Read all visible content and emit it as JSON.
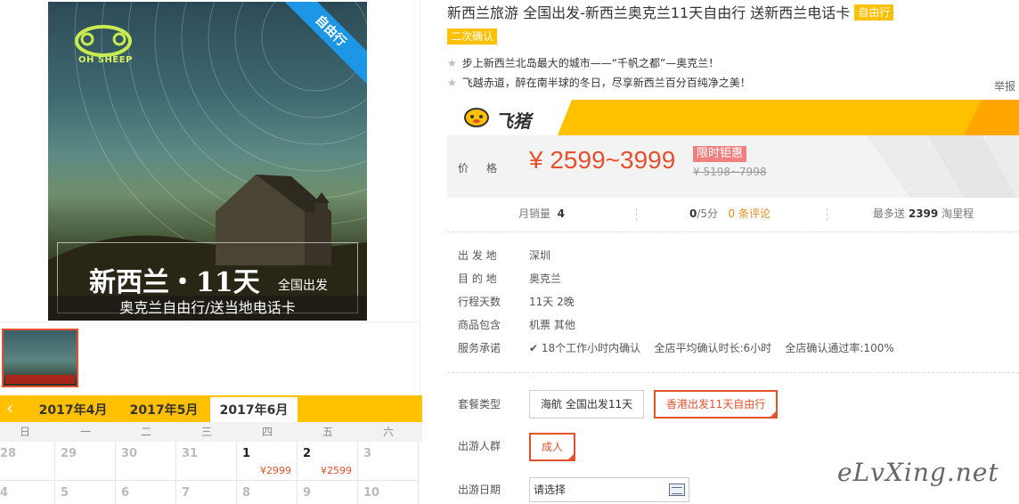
{
  "gallery": {
    "ribbon": "自由行",
    "logo_text": "OH SHEEP",
    "image_title": "新西兰・11天",
    "image_subtitle": "全国出发",
    "image_caption": "奥克兰自由行/送当地电话卡"
  },
  "calendar": {
    "prev_icon": "chevron-left-icon",
    "tabs": [
      {
        "label": "2017年4月",
        "active": false
      },
      {
        "label": "2017年5月",
        "active": false
      },
      {
        "label": "2017年6月",
        "active": true
      }
    ],
    "weekdays": [
      "日",
      "一",
      "二",
      "三",
      "四",
      "五",
      "六"
    ],
    "week1": [
      {
        "day": "28",
        "price": "",
        "on": false
      },
      {
        "day": "29",
        "price": "",
        "on": false
      },
      {
        "day": "30",
        "price": "",
        "on": false
      },
      {
        "day": "31",
        "price": "",
        "on": false
      },
      {
        "day": "1",
        "price": "¥2999",
        "on": true
      },
      {
        "day": "2",
        "price": "¥2599",
        "on": true
      },
      {
        "day": "3",
        "price": "",
        "on": false
      }
    ],
    "week2": [
      {
        "day": "4",
        "price": "",
        "on": false
      },
      {
        "day": "5",
        "price": "",
        "on": false
      },
      {
        "day": "6",
        "price": "",
        "on": false
      },
      {
        "day": "7",
        "price": "",
        "on": false
      },
      {
        "day": "8",
        "price": "",
        "on": false
      },
      {
        "day": "9",
        "price": "",
        "on": false
      },
      {
        "day": "10",
        "price": "",
        "on": false
      }
    ]
  },
  "product": {
    "title": "新西兰旅游 全国出发-新西兰奥克兰11天自由行 送新西兰电话卡",
    "tag_free": "自由行",
    "tag_confirm": "二次确认",
    "features": [
      "步上新西兰北岛最大的城市——“千帆之都”—奥克兰！",
      "飞越赤道，醉在南半球的冬日，尽享新西兰百分百纯净之美！"
    ],
    "report": "举报"
  },
  "price_box": {
    "brand": "飞猪",
    "label": "价格",
    "price": "¥ 2599~3999",
    "promo": "限时钜惠",
    "old_price": "¥ 5198~7998"
  },
  "stats": {
    "monthly_label": "月销量",
    "monthly_value": "4",
    "score_value": "0",
    "score_unit": "/5分",
    "reviews": "0 条评论",
    "miles_prefix": "最多送",
    "miles_value": "2399",
    "miles_suffix": "淘里程"
  },
  "info": [
    {
      "key": "出 发 地",
      "value": "深圳"
    },
    {
      "key": "目 的 地",
      "value": "奥克兰"
    },
    {
      "key": "行程天数",
      "value": "11天 2晚"
    },
    {
      "key": "商品包含",
      "value": "机票   其他"
    }
  ],
  "service": {
    "key": "服务承诺",
    "items": [
      "18个工作小时内确认",
      "全店平均确认时长:6小时",
      "全店确认通过率:100%"
    ]
  },
  "options": {
    "package_label": "套餐类型",
    "packages": [
      {
        "label": "海航 全国出发11天",
        "selected": false
      },
      {
        "label": "香港出发11天自由行",
        "selected": true
      }
    ],
    "people_label": "出游人群",
    "people": [
      {
        "label": "成人",
        "selected": true
      }
    ],
    "date_label": "出游日期",
    "date_value": "请选择"
  },
  "watermark": "eLvXing.net",
  "colors": {
    "accent": "#ffc000",
    "price": "#e5512e",
    "ribbon": "#1e96e6"
  }
}
